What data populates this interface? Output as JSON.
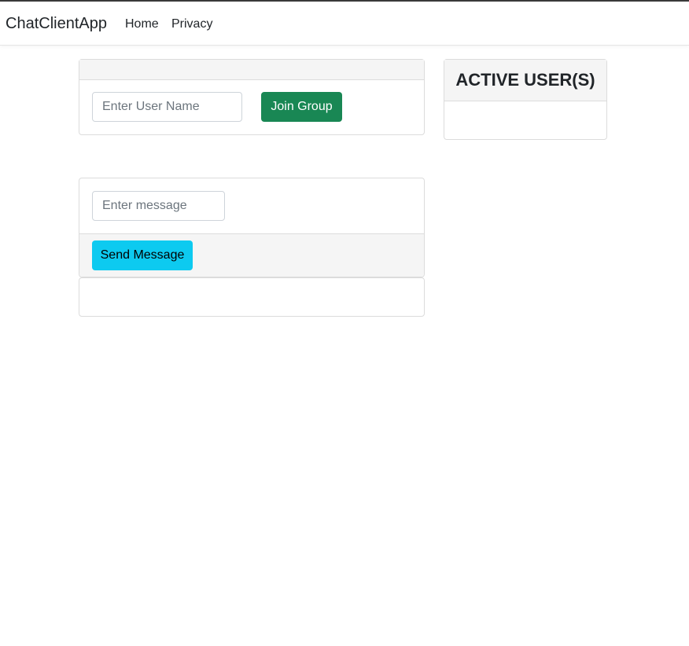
{
  "navbar": {
    "brand": "ChatClientApp",
    "links": [
      "Home",
      "Privacy"
    ]
  },
  "join_panel": {
    "username_placeholder": "Enter User Name",
    "join_button_label": "Join Group"
  },
  "active_users_panel": {
    "title": "ACTIVE USER(S)"
  },
  "message_panel": {
    "message_placeholder": "Enter message",
    "send_button_label": "Send Message"
  },
  "colors": {
    "join_button": "#198754",
    "send_button": "#0dcaf0",
    "card_header": "#f5f5f5"
  }
}
